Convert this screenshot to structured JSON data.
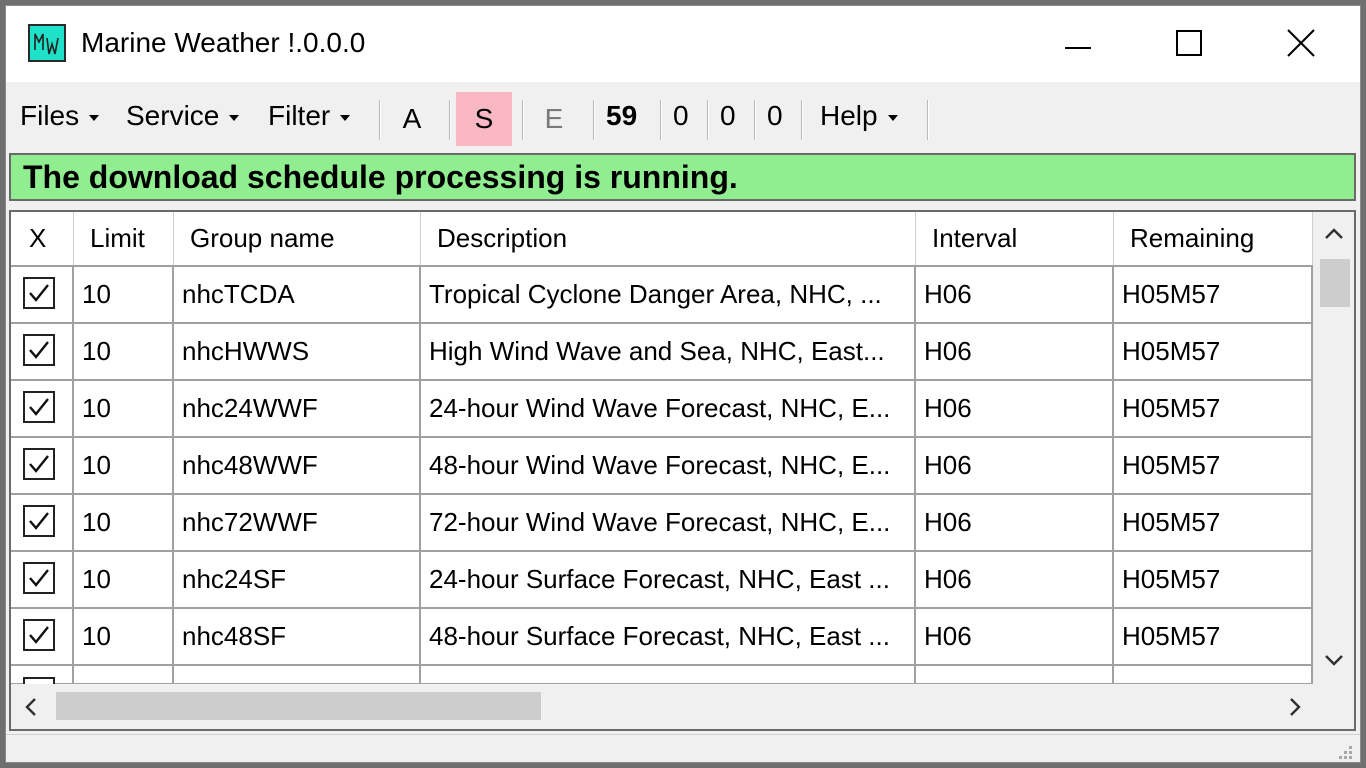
{
  "window": {
    "title": "Marine Weather !.0.0.0",
    "app_icon_name": "mw-app-icon",
    "controls": [
      "minimize-icon",
      "maximize-icon",
      "close-icon"
    ]
  },
  "menu": {
    "files": "Files",
    "service": "Service",
    "filter": "Filter",
    "btn_a": "A",
    "btn_s": "S",
    "btn_e": "E",
    "count_1": "59",
    "count_2": "0",
    "count_3": "0",
    "count_4": "0",
    "help": "Help"
  },
  "status_banner": {
    "text": "The download schedule processing is running.",
    "color": "#90ee90"
  },
  "active_button_color": "#f8b7c2",
  "grid": {
    "columns": [
      "X",
      "Limit",
      "Group name",
      "Description",
      "Interval",
      "Remaining"
    ],
    "rows": [
      {
        "checked": true,
        "limit": "10",
        "group": "nhcTCDA",
        "description": "Tropical Cyclone Danger Area, NHC, ...",
        "interval": "H06",
        "remaining": "H05M57"
      },
      {
        "checked": true,
        "limit": "10",
        "group": "nhcHWWS",
        "description": "High Wind Wave and Sea, NHC, East...",
        "interval": "H06",
        "remaining": "H05M57"
      },
      {
        "checked": true,
        "limit": "10",
        "group": "nhc24WWF",
        "description": "24-hour Wind Wave Forecast, NHC, E...",
        "interval": "H06",
        "remaining": "H05M57"
      },
      {
        "checked": true,
        "limit": "10",
        "group": "nhc48WWF",
        "description": "48-hour Wind Wave Forecast, NHC, E...",
        "interval": "H06",
        "remaining": "H05M57"
      },
      {
        "checked": true,
        "limit": "10",
        "group": "nhc72WWF",
        "description": "72-hour Wind Wave Forecast, NHC, E...",
        "interval": "H06",
        "remaining": "H05M57"
      },
      {
        "checked": true,
        "limit": "10",
        "group": "nhc24SF",
        "description": "24-hour Surface Forecast, NHC, East ...",
        "interval": "H06",
        "remaining": "H05M57"
      },
      {
        "checked": true,
        "limit": "10",
        "group": "nhc48SF",
        "description": "48-hour Surface Forecast, NHC, East ...",
        "interval": "H06",
        "remaining": "H05M57"
      }
    ]
  }
}
